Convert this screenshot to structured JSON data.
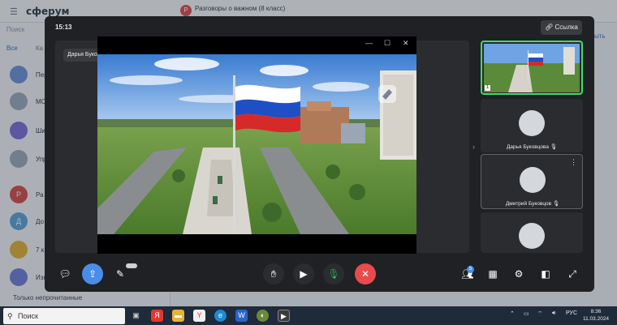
{
  "background_app": {
    "logo": "сферум",
    "chat_title": "Разговоры о важном (8 класс)",
    "search_placeholder": "Поиск",
    "filter_tabs": [
      "Все",
      "Ка"
    ],
    "right_link": "ыть",
    "unread_toggle": "Только непрочитанные",
    "list_items": [
      {
        "initial": "",
        "text": "Пере",
        "color": "#6b8fd6"
      },
      {
        "initial": "",
        "text": "МС",
        "color": "#9aa6b8"
      },
      {
        "initial": "",
        "text": "Ши",
        "color": "#7a6bd6"
      },
      {
        "initial": "",
        "text": "Упр",
        "color": "#9aa6b8"
      },
      {
        "initial": "Р",
        "text": "Ра",
        "color": "#d64848"
      },
      {
        "initial": "Д",
        "text": "До",
        "color": "#5aa0d6"
      },
      {
        "initial": "",
        "text": "7 к",
        "color": "#e0b030"
      },
      {
        "initial": "",
        "text": "Изк",
        "color": "#6b7bd6"
      }
    ]
  },
  "call": {
    "time": "15:13",
    "link_button": "Ссылка",
    "speaker_label": "Дарья Буко",
    "participants": [
      {
        "name": ""
      },
      {
        "name": "Дарья Буковцова"
      },
      {
        "name": "Дмитрий Буковцов"
      },
      {
        "name": ""
      }
    ],
    "participant_count": "5"
  },
  "taskbar": {
    "search": "Поиск",
    "language": "РУС",
    "time": "8:36",
    "date": "11.03.2024"
  },
  "colors": {
    "accent": "#4a8de8",
    "hangup": "#e94b4b",
    "mic": "#34a853",
    "active_tile_border": "#3ddc6a"
  }
}
